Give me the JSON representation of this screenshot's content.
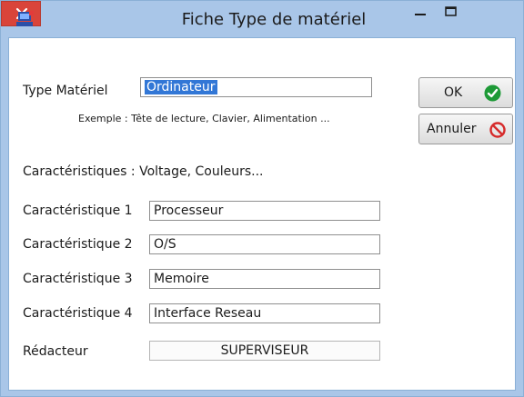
{
  "window": {
    "title": "Fiche Type de matériel"
  },
  "form": {
    "type_label": "Type Matériel",
    "type_value": "Ordinateur",
    "example_text": "Exemple : Tête de lecture, Clavier, Alimentation ...",
    "caracteristiques_heading": "Caractéristiques : Voltage, Couleurs...",
    "caracteristiques": [
      {
        "label": "Caractéristique 1",
        "value": "Processeur"
      },
      {
        "label": "Caractéristique 2",
        "value": "O/S"
      },
      {
        "label": "Caractéristique 3",
        "value": "Memoire"
      },
      {
        "label": "Caractéristique 4",
        "value": "Interface Reseau"
      }
    ],
    "redacteur_label": "Rédacteur",
    "redacteur_value": "SUPERVISEUR"
  },
  "buttons": {
    "ok_label": "OK",
    "cancel_label": "Annuler"
  },
  "colors": {
    "titlebar": "#a9c6e8",
    "close_button": "#d9443a",
    "selection": "#3277d6",
    "ok_check": "#1e9a37",
    "cancel_icon": "#d62a2a"
  }
}
